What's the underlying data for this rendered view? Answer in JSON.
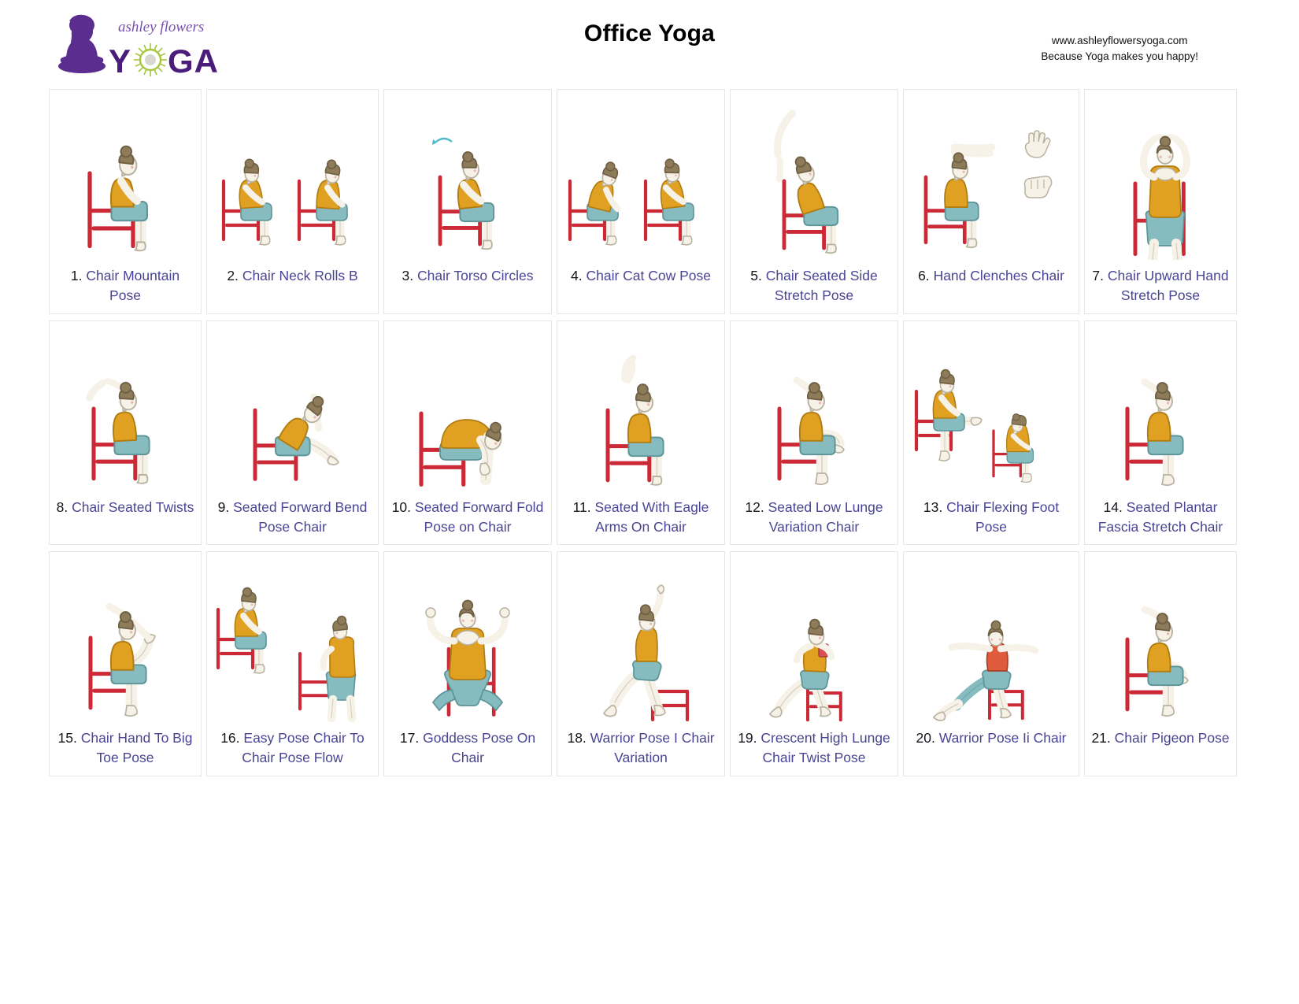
{
  "header": {
    "title": "Office Yoga",
    "logo": {
      "brand_script": "ashley flowers",
      "brand_main": "YOGA",
      "icon": "meditating-figure-lotus-silhouette",
      "flower_icon": "green-daisy-flower"
    },
    "site_url": "www.ashleyflowersyoga.com",
    "tagline": "Because Yoga makes you happy!"
  },
  "colors": {
    "title_text": "#000000",
    "pose_name_text": "#4a4494",
    "pose_number_text": "#16161d",
    "cell_border": "#e6e6e6",
    "chair_red": "#cc2936",
    "top_orange": "#e0a021",
    "shorts_teal": "#86bcc0",
    "skin_cream": "#f6f2e8",
    "hair_brown": "#8d7b5a",
    "logo_purple": "#5b2d8e",
    "logo_green": "#a7c53d",
    "page_background": "#ffffff"
  },
  "grid": {
    "columns": 7,
    "rows": 3,
    "total_poses": 21
  },
  "poses": [
    {
      "number": "1.",
      "name": "Chair Mountain Pose",
      "art": "seated-upright-side",
      "figures": 1
    },
    {
      "number": "2.",
      "name": "Chair Neck Rolls B",
      "art": "seated-neck-roll-pair",
      "figures": 2
    },
    {
      "number": "3.",
      "name": "Chair Torso Circles",
      "art": "seated-torso-circle",
      "figures": 1
    },
    {
      "number": "4.",
      "name": "Chair Cat Cow Pose",
      "art": "seated-cat-cow-pair",
      "figures": 2
    },
    {
      "number": "5.",
      "name": "Chair Seated Side Stretch Pose",
      "art": "seated-side-stretch",
      "figures": 1
    },
    {
      "number": "6.",
      "name": "Hand Clenches Chair",
      "art": "seated-arms-forward-hands",
      "figures": 1
    },
    {
      "number": "7.",
      "name": "Chair Upward Hand Stretch Pose",
      "art": "seated-arms-overhead-front",
      "figures": 1
    },
    {
      "number": "8.",
      "name": "Chair Seated Twists",
      "art": "seated-twist",
      "figures": 1
    },
    {
      "number": "9.",
      "name": "Seated Forward Bend Pose Chair",
      "art": "seated-forward-bend",
      "figures": 1
    },
    {
      "number": "10.",
      "name": "Seated Forward Fold Pose on Chair",
      "art": "seated-forward-fold",
      "figures": 1
    },
    {
      "number": "11.",
      "name": "Seated With Eagle Arms On Chair",
      "art": "seated-eagle-arms",
      "figures": 1
    },
    {
      "number": "12.",
      "name": "Seated Low Lunge Variation Chair",
      "art": "seated-figure-four",
      "figures": 1
    },
    {
      "number": "13.",
      "name": "Chair Flexing Foot Pose",
      "art": "seated-leg-extend-pair",
      "figures": 2
    },
    {
      "number": "14.",
      "name": "Seated Plantar Fascia Stretch Chair",
      "art": "seated-ankle-cross",
      "figures": 1
    },
    {
      "number": "15.",
      "name": "Chair Hand To Big Toe Pose",
      "art": "seated-hand-to-toe",
      "figures": 1
    },
    {
      "number": "16.",
      "name": "Easy Pose Chair To Chair Pose Flow",
      "art": "seated-to-standing-pair",
      "figures": 2
    },
    {
      "number": "17.",
      "name": "Goddess Pose On Chair",
      "art": "goddess-cactus-arms-front",
      "figures": 1
    },
    {
      "number": "18.",
      "name": "Warrior Pose I Chair Variation",
      "art": "warrior-one-chair",
      "figures": 1
    },
    {
      "number": "19.",
      "name": "Crescent High Lunge Chair Twist Pose",
      "art": "crescent-lunge-twist",
      "figures": 1
    },
    {
      "number": "20.",
      "name": "Warrior Pose Ii Chair",
      "art": "warrior-two-chair",
      "figures": 1
    },
    {
      "number": "21.",
      "name": "Chair Pigeon Pose",
      "art": "chair-pigeon",
      "figures": 1
    }
  ]
}
